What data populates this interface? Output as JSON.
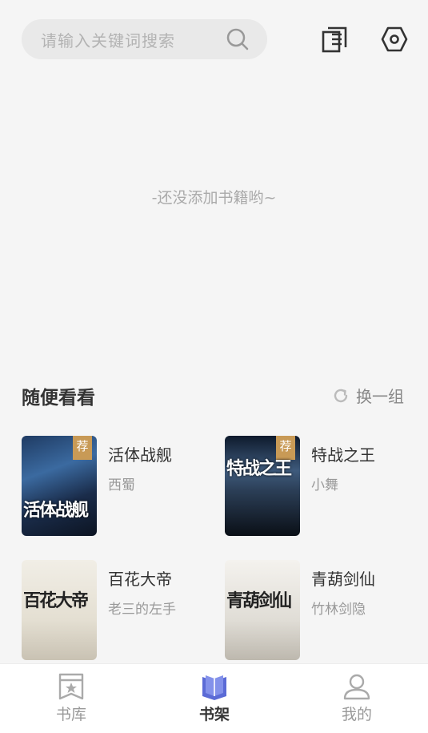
{
  "search": {
    "placeholder": "请输入关键词搜索"
  },
  "icons": {
    "search": "search-icon",
    "shelf_edit": "bookshelf-edit-icon",
    "settings": "settings-icon"
  },
  "empty_state": "-还没添加书籍哟~",
  "section": {
    "title": "随便看看",
    "refresh_label": "换一组"
  },
  "books": [
    {
      "name": "活体战舰",
      "author": "西蜀",
      "cover_title": "活体战舰",
      "badge": "荐"
    },
    {
      "name": "特战之王",
      "author": "小舞",
      "cover_title": "特战之王",
      "badge": "荐"
    },
    {
      "name": "百花大帝",
      "author": "老三的左手",
      "cover_title": "百花大帝"
    },
    {
      "name": "青葫剑仙",
      "author": "竹林剑隐",
      "cover_title": "青葫剑仙"
    }
  ],
  "tabs": [
    {
      "label": "书库",
      "icon": "library-icon"
    },
    {
      "label": "书架",
      "icon": "bookshelf-icon",
      "active": true
    },
    {
      "label": "我的",
      "icon": "profile-icon"
    }
  ],
  "colors": {
    "accent": "#5b6bd6",
    "badge": "#c89a56",
    "background": "#f5f5f5"
  }
}
